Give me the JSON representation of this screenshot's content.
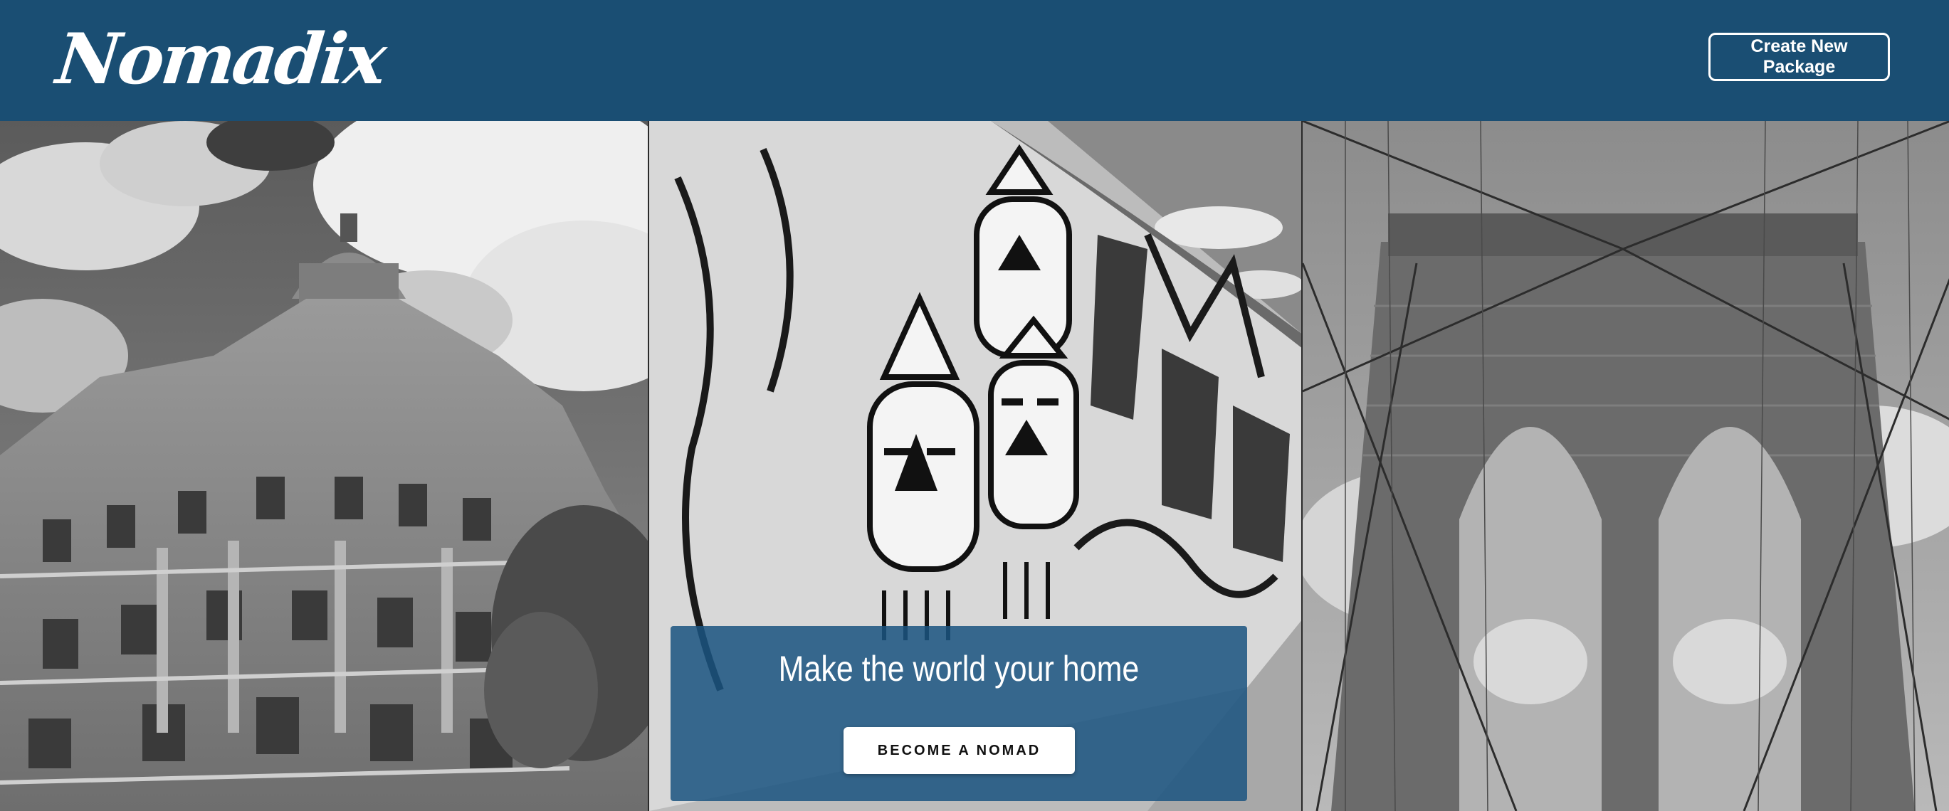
{
  "header": {
    "logo_text": "Nomadix",
    "create_package_label": "Create New Package"
  },
  "hero": {
    "photos": [
      {
        "subject": "ornate domed historic building under a cloudy sky"
      },
      {
        "subject": "graffiti-covered wall with cartoon faces"
      },
      {
        "subject": "suspension bridge stone tower with cables"
      }
    ],
    "headline": "Make the world your home",
    "cta_label": "BECOME A NOMAD"
  },
  "colors": {
    "brand_blue": "#1a4e73",
    "panel_blue": "#1b5480",
    "white": "#ffffff"
  }
}
